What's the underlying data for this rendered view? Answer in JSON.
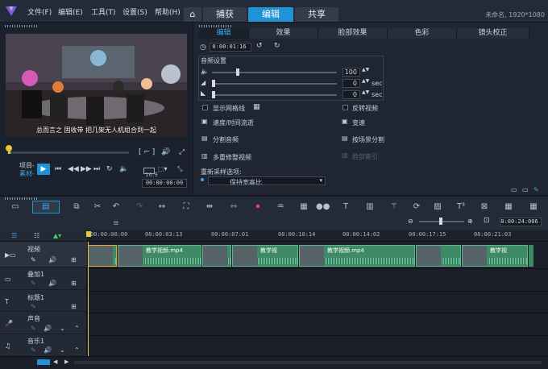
{
  "menu": [
    "文件(F)",
    "编辑(E)",
    "工具(T)",
    "设置(S)",
    "帮助(H)"
  ],
  "tabs": {
    "capture": "捕获",
    "edit": "编辑",
    "share": "共享"
  },
  "resolution": "未命名, 1920*1080",
  "preview": {
    "subtitle": "总而言之 固收带 把几架无人机组合到一起",
    "project_label": "项目-",
    "clip_label": "素材-",
    "timecode": "00:00:00:00",
    "zoom": "16:9",
    "scrub_progress": 0.02
  },
  "edit_tabs": [
    "编辑",
    "效果",
    "脸部效果",
    "色彩",
    "镜头校正"
  ],
  "edit": {
    "timecode": "0:00:01:16",
    "audio_settings": "音频设置",
    "volume": "100",
    "fade_in": "0",
    "fade_out": "0",
    "sec": "sec",
    "opts_left": [
      "显示网格线",
      "速度/时间流逝",
      "分割音频",
      "多重修整视频"
    ],
    "opts_right": [
      "反转视频",
      "变速",
      "按场景分割",
      "脸部索引"
    ],
    "resample_label": "重新采样选项:",
    "resample_value": "保持宽高比"
  },
  "timeline": {
    "timecode": "0:00:24:006",
    "ruler": [
      "00:00:00:00",
      "00:00:03:13",
      "00:00:07:01",
      "00:00:10:14",
      "00:00:14:02",
      "00:00:17:15",
      "00:00:21:03"
    ],
    "tracks": [
      "视频",
      "叠加1",
      "标题1",
      "声音",
      "音乐1"
    ],
    "clip_name": "教学视频.mp4",
    "clip_name_short": "教学视"
  },
  "icons": {
    "app": "videostudio-logo",
    "home": "home-icon"
  }
}
